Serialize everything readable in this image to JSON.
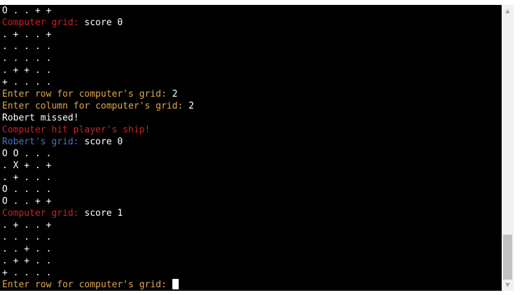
{
  "terminal": {
    "lines": [
      {
        "segments": [
          {
            "text": "O . . + +",
            "color": "white"
          }
        ]
      },
      {
        "segments": [
          {
            "text": "Computer grid:",
            "color": "red"
          },
          {
            "text": " score 0",
            "color": "white"
          }
        ]
      },
      {
        "segments": [
          {
            "text": ". + . . +",
            "color": "white"
          }
        ]
      },
      {
        "segments": [
          {
            "text": ". . . . .",
            "color": "white"
          }
        ]
      },
      {
        "segments": [
          {
            "text": ". . . . .",
            "color": "white"
          }
        ]
      },
      {
        "segments": [
          {
            "text": ". + + . .",
            "color": "white"
          }
        ]
      },
      {
        "segments": [
          {
            "text": "+ . . . .",
            "color": "white"
          }
        ]
      },
      {
        "segments": [
          {
            "text": "Enter row for computer's grid:",
            "color": "yellow"
          },
          {
            "text": " 2",
            "color": "white"
          }
        ]
      },
      {
        "segments": [
          {
            "text": "Enter column for computer's grid:",
            "color": "yellow"
          },
          {
            "text": " 2",
            "color": "white"
          }
        ]
      },
      {
        "segments": [
          {
            "text": "Robert missed!",
            "color": "white"
          }
        ]
      },
      {
        "segments": [
          {
            "text": "Computer hit player's ship!",
            "color": "red"
          }
        ]
      },
      {
        "segments": [
          {
            "text": "Robert's grid:",
            "color": "blue"
          },
          {
            "text": " score 0",
            "color": "white"
          }
        ]
      },
      {
        "segments": [
          {
            "text": "O O . . .",
            "color": "white"
          }
        ]
      },
      {
        "segments": [
          {
            "text": ". X + . +",
            "color": "white"
          }
        ]
      },
      {
        "segments": [
          {
            "text": ". + . . .",
            "color": "white"
          }
        ]
      },
      {
        "segments": [
          {
            "text": "O . . . .",
            "color": "white"
          }
        ]
      },
      {
        "segments": [
          {
            "text": "O . . + +",
            "color": "white"
          }
        ]
      },
      {
        "segments": [
          {
            "text": "Computer grid:",
            "color": "red"
          },
          {
            "text": " score 1",
            "color": "white"
          }
        ]
      },
      {
        "segments": [
          {
            "text": ". + . . +",
            "color": "white"
          }
        ]
      },
      {
        "segments": [
          {
            "text": ". . . . .",
            "color": "white"
          }
        ]
      },
      {
        "segments": [
          {
            "text": ". . + . .",
            "color": "white"
          }
        ]
      },
      {
        "segments": [
          {
            "text": ". + + . .",
            "color": "white"
          }
        ]
      },
      {
        "segments": [
          {
            "text": "+ . . . .",
            "color": "white"
          }
        ]
      },
      {
        "segments": [
          {
            "text": "Enter row for computer's grid:",
            "color": "yellow"
          },
          {
            "text": " ",
            "color": "white"
          }
        ],
        "cursor": true
      }
    ]
  },
  "colors": {
    "background": "#000000",
    "text": "#ffffff",
    "red": "#cc2222",
    "yellow": "#e0a84a",
    "blue": "#4a6fc9"
  },
  "scrollbar": {
    "up_icon": "scroll-up-arrow-icon",
    "down_icon": "scroll-down-arrow-icon"
  }
}
